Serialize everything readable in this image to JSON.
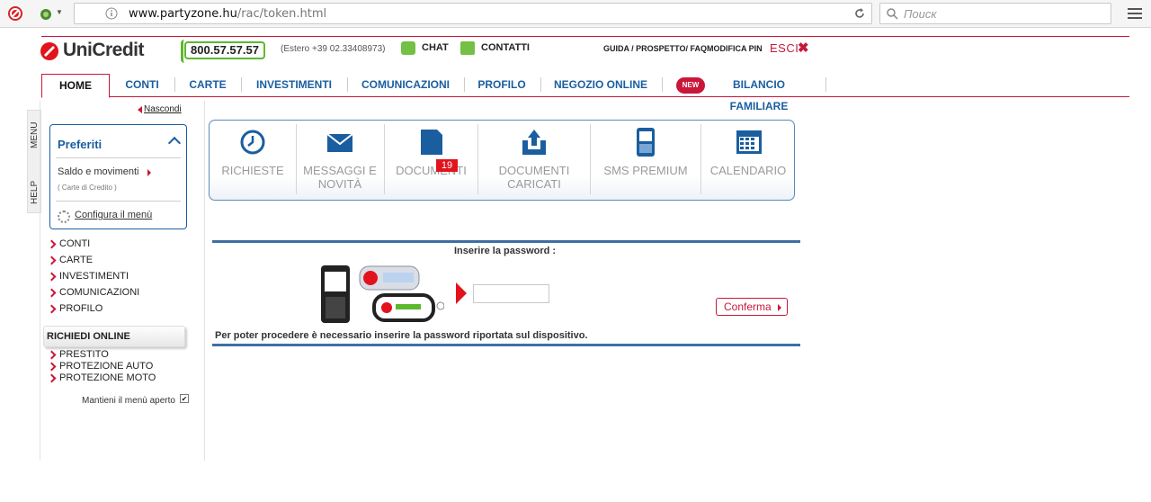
{
  "browser": {
    "url_host": "www.partyzone.hu",
    "url_path": "/rac/token.html",
    "search_placeholder": "Поиск"
  },
  "header": {
    "logo": "UniCredit",
    "phone": "800.57.57.57",
    "estero": "(Estero +39 02.33408973)",
    "chat": "CHAT",
    "contatti": "CONTATTI",
    "guida": "GUIDA / PROSPETTO/ FAQ",
    "modifica_pin": "MODIFICA PIN",
    "esci": "ESCI",
    "esci_x": "✖"
  },
  "nav": {
    "home": "HOME",
    "conti": "CONTI",
    "carte": "CARTE",
    "investimenti": "INVESTIMENTI",
    "comunicazioni": "COMUNICAZIONI",
    "profilo": "PROFILO",
    "negozio": "NEGOZIO ONLINE",
    "new_badge": "NEW",
    "bilancio": "BILANCIO FAMILIARE"
  },
  "side_tabs": {
    "menu": "MENU",
    "help": "HELP"
  },
  "sidebar": {
    "nascondi": "Nascondi",
    "preferiti_title": "Preferiti",
    "saldo": "Saldo e movimenti",
    "carte_credito": "( Carte di Credito )",
    "configura": "Configura il menù",
    "menu": [
      "CONTI",
      "CARTE",
      "INVESTIMENTI",
      "COMUNICAZIONI",
      "PROFILO"
    ],
    "richiedi_title": "RICHIEDI ONLINE",
    "richiedi": [
      "PRESTITO",
      "PROTEZIONE AUTO",
      "PROTEZIONE MOTO"
    ],
    "mantieni": "Mantieni il menù aperto",
    "mantieni_checked": "✔"
  },
  "quick_links": {
    "richieste": "RICHIESTE",
    "messaggi_1": "MESSAGGI E",
    "messaggi_2": "NOVITÀ",
    "documenti": "DOCUMENTI",
    "documenti_badge": "19",
    "caricati_1": "DOCUMENTI",
    "caricati_2": "CARICATI",
    "sms": "SMS PREMIUM",
    "calendario": "CALENDARIO"
  },
  "password": {
    "title": "Inserire la password :",
    "value": "",
    "conferma": "Conferma",
    "note": "Per poter procedere è necessario inserire la password riportata sul dispositivo."
  },
  "colors": {
    "brand_red": "#c9173a",
    "nav_blue": "#1a5ea0",
    "green": "#5cb82e"
  }
}
